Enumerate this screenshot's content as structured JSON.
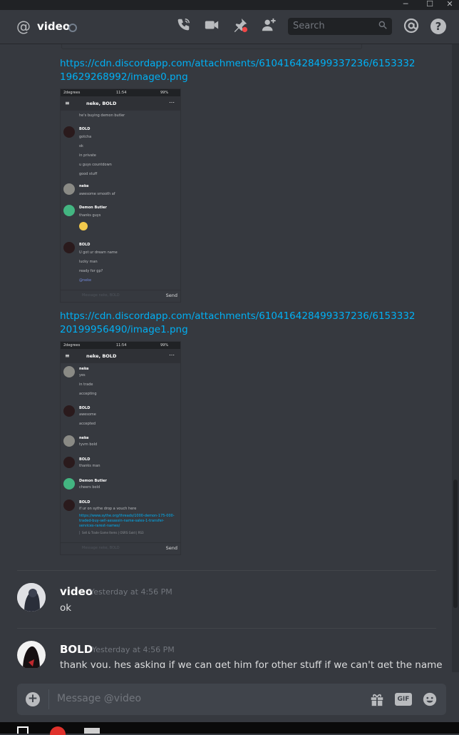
{
  "window": {
    "minimize": "─",
    "maximize": "☐",
    "close": "✕"
  },
  "header": {
    "at_symbol": "@",
    "title": "video",
    "search_placeholder": "Search",
    "help": "?"
  },
  "attachments": [
    {
      "url": "https://cdn.discordapp.com/attachments/610416428499337236/615333219629268992/image0.png",
      "phone": {
        "carrier": "2degrees",
        "time": "11:54",
        "battery": "99%",
        "chat_title": "neke, BOLD",
        "send": "Send",
        "footer_placeholder": "Message neke, BOLD",
        "messages": [
          {
            "name": "",
            "date": "",
            "lines": [
              "he's buying demon butler"
            ]
          },
          {
            "name": "BOLD",
            "date": "08/14/2019",
            "lines": [
              "gotcha",
              "ok",
              "in private",
              "u guys countdown",
              "good stuff"
            ]
          },
          {
            "name": "neke",
            "date": "08/14/2019",
            "lines": [
              "awesome smooth af"
            ]
          },
          {
            "name": "Demon Butler",
            "date": "08/14/2019",
            "lines": [
              "thanks guys"
            ]
          },
          {
            "name": "BOLD",
            "date": "08/14/2019",
            "lines": [
              "U got ur dream name",
              "lucky man",
              "ready for gp?",
              "@neke"
            ]
          }
        ]
      }
    },
    {
      "url": "https://cdn.discordapp.com/attachments/610416428499337236/615333220199956490/image1.png",
      "phone": {
        "carrier": "2degrees",
        "time": "11:54",
        "battery": "99%",
        "chat_title": "neke, BOLD",
        "send": "Send",
        "footer_placeholder": "Message neke, BOLD",
        "messages": [
          {
            "name": "neke",
            "date": "08/14/2019",
            "lines": [
              "yes",
              "in trade",
              "accepting"
            ]
          },
          {
            "name": "BOLD",
            "date": "08/14/2019",
            "lines": [
              "awesome",
              "accepted"
            ]
          },
          {
            "name": "neke",
            "date": "08/14/2019",
            "lines": [
              "tyvm bold"
            ]
          },
          {
            "name": "BOLD",
            "date": "08/14/2019",
            "lines": [
              "thanks man"
            ]
          },
          {
            "name": "Demon Butler",
            "date": "08/14/2019",
            "lines": [
              "cheers bold"
            ]
          },
          {
            "name": "BOLD",
            "date": "08/14/2019",
            "lines": [
              "if ur on sythe drop a vouch here"
            ],
            "link": "https://www.sythe.org/threads/1000-demon-175-000-traded-buy-sell-assassin-name-sales-1-transfer-services-rarest-names/",
            "embed": "Sell & Trade Game Items | OSRS Gold | RS3"
          }
        ]
      }
    }
  ],
  "messages": [
    {
      "author": "video",
      "timestamp": "Yesterday at 4:56 PM",
      "text": "ok"
    },
    {
      "author": "BOLD",
      "timestamp": "Yesterday at 4:56 PM",
      "text": "thank you, hes asking if we can get him for other stuff if we can't get the name"
    }
  ],
  "composer": {
    "placeholder": "Message @video",
    "gif": "GIF"
  },
  "colors": {
    "accent": "#00b0f4",
    "background": "#36393f",
    "input": "#40444b",
    "demon_butler": "#43b581"
  },
  "icons": [
    "at-icon",
    "status-icon",
    "call-icon",
    "video-icon",
    "pin-icon",
    "add-member-icon",
    "search-icon",
    "mention-icon",
    "help-icon",
    "plus-icon",
    "gift-icon",
    "gif-icon",
    "emoji-icon"
  ]
}
